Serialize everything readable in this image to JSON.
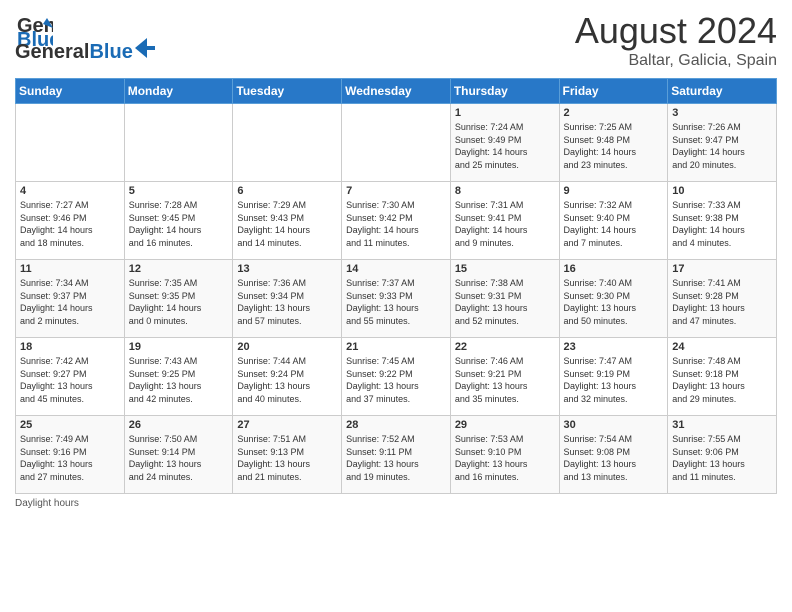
{
  "header": {
    "logo_general": "General",
    "logo_blue": "Blue",
    "month_year": "August 2024",
    "location": "Baltar, Galicia, Spain"
  },
  "weekdays": [
    "Sunday",
    "Monday",
    "Tuesday",
    "Wednesday",
    "Thursday",
    "Friday",
    "Saturday"
  ],
  "footer": {
    "daylight_hours": "Daylight hours"
  },
  "weeks": [
    [
      {
        "day": "",
        "info": ""
      },
      {
        "day": "",
        "info": ""
      },
      {
        "day": "",
        "info": ""
      },
      {
        "day": "",
        "info": ""
      },
      {
        "day": "1",
        "info": "Sunrise: 7:24 AM\nSunset: 9:49 PM\nDaylight: 14 hours\nand 25 minutes."
      },
      {
        "day": "2",
        "info": "Sunrise: 7:25 AM\nSunset: 9:48 PM\nDaylight: 14 hours\nand 23 minutes."
      },
      {
        "day": "3",
        "info": "Sunrise: 7:26 AM\nSunset: 9:47 PM\nDaylight: 14 hours\nand 20 minutes."
      }
    ],
    [
      {
        "day": "4",
        "info": "Sunrise: 7:27 AM\nSunset: 9:46 PM\nDaylight: 14 hours\nand 18 minutes."
      },
      {
        "day": "5",
        "info": "Sunrise: 7:28 AM\nSunset: 9:45 PM\nDaylight: 14 hours\nand 16 minutes."
      },
      {
        "day": "6",
        "info": "Sunrise: 7:29 AM\nSunset: 9:43 PM\nDaylight: 14 hours\nand 14 minutes."
      },
      {
        "day": "7",
        "info": "Sunrise: 7:30 AM\nSunset: 9:42 PM\nDaylight: 14 hours\nand 11 minutes."
      },
      {
        "day": "8",
        "info": "Sunrise: 7:31 AM\nSunset: 9:41 PM\nDaylight: 14 hours\nand 9 minutes."
      },
      {
        "day": "9",
        "info": "Sunrise: 7:32 AM\nSunset: 9:40 PM\nDaylight: 14 hours\nand 7 minutes."
      },
      {
        "day": "10",
        "info": "Sunrise: 7:33 AM\nSunset: 9:38 PM\nDaylight: 14 hours\nand 4 minutes."
      }
    ],
    [
      {
        "day": "11",
        "info": "Sunrise: 7:34 AM\nSunset: 9:37 PM\nDaylight: 14 hours\nand 2 minutes."
      },
      {
        "day": "12",
        "info": "Sunrise: 7:35 AM\nSunset: 9:35 PM\nDaylight: 14 hours\nand 0 minutes."
      },
      {
        "day": "13",
        "info": "Sunrise: 7:36 AM\nSunset: 9:34 PM\nDaylight: 13 hours\nand 57 minutes."
      },
      {
        "day": "14",
        "info": "Sunrise: 7:37 AM\nSunset: 9:33 PM\nDaylight: 13 hours\nand 55 minutes."
      },
      {
        "day": "15",
        "info": "Sunrise: 7:38 AM\nSunset: 9:31 PM\nDaylight: 13 hours\nand 52 minutes."
      },
      {
        "day": "16",
        "info": "Sunrise: 7:40 AM\nSunset: 9:30 PM\nDaylight: 13 hours\nand 50 minutes."
      },
      {
        "day": "17",
        "info": "Sunrise: 7:41 AM\nSunset: 9:28 PM\nDaylight: 13 hours\nand 47 minutes."
      }
    ],
    [
      {
        "day": "18",
        "info": "Sunrise: 7:42 AM\nSunset: 9:27 PM\nDaylight: 13 hours\nand 45 minutes."
      },
      {
        "day": "19",
        "info": "Sunrise: 7:43 AM\nSunset: 9:25 PM\nDaylight: 13 hours\nand 42 minutes."
      },
      {
        "day": "20",
        "info": "Sunrise: 7:44 AM\nSunset: 9:24 PM\nDaylight: 13 hours\nand 40 minutes."
      },
      {
        "day": "21",
        "info": "Sunrise: 7:45 AM\nSunset: 9:22 PM\nDaylight: 13 hours\nand 37 minutes."
      },
      {
        "day": "22",
        "info": "Sunrise: 7:46 AM\nSunset: 9:21 PM\nDaylight: 13 hours\nand 35 minutes."
      },
      {
        "day": "23",
        "info": "Sunrise: 7:47 AM\nSunset: 9:19 PM\nDaylight: 13 hours\nand 32 minutes."
      },
      {
        "day": "24",
        "info": "Sunrise: 7:48 AM\nSunset: 9:18 PM\nDaylight: 13 hours\nand 29 minutes."
      }
    ],
    [
      {
        "day": "25",
        "info": "Sunrise: 7:49 AM\nSunset: 9:16 PM\nDaylight: 13 hours\nand 27 minutes."
      },
      {
        "day": "26",
        "info": "Sunrise: 7:50 AM\nSunset: 9:14 PM\nDaylight: 13 hours\nand 24 minutes."
      },
      {
        "day": "27",
        "info": "Sunrise: 7:51 AM\nSunset: 9:13 PM\nDaylight: 13 hours\nand 21 minutes."
      },
      {
        "day": "28",
        "info": "Sunrise: 7:52 AM\nSunset: 9:11 PM\nDaylight: 13 hours\nand 19 minutes."
      },
      {
        "day": "29",
        "info": "Sunrise: 7:53 AM\nSunset: 9:10 PM\nDaylight: 13 hours\nand 16 minutes."
      },
      {
        "day": "30",
        "info": "Sunrise: 7:54 AM\nSunset: 9:08 PM\nDaylight: 13 hours\nand 13 minutes."
      },
      {
        "day": "31",
        "info": "Sunrise: 7:55 AM\nSunset: 9:06 PM\nDaylight: 13 hours\nand 11 minutes."
      }
    ]
  ]
}
